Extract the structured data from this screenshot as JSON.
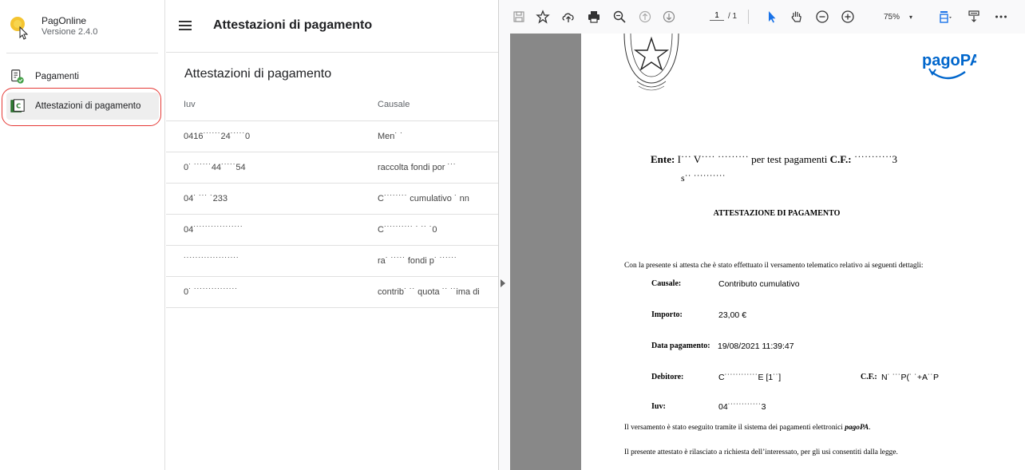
{
  "app": {
    "name": "PagOnline",
    "version": "Versione 2.4.0"
  },
  "sidebar": {
    "items": [
      {
        "label": "Pagamenti",
        "icon": "document-check-icon"
      },
      {
        "label": "Attestazioni di pagamento",
        "icon": "receipt-icon",
        "active": true
      }
    ]
  },
  "header": {
    "title": "Attestazioni di pagamento"
  },
  "list": {
    "title": "Attestazioni di pagamento",
    "columns": [
      "Iuv",
      "Causale"
    ],
    "rows": [
      {
        "iuv": "0416˙˙˙˙˙˙24˙˙˙˙˙0",
        "causale": "Men˙ ˙"
      },
      {
        "iuv": "0˙ ˙˙˙˙˙˙44˙˙˙˙˙54",
        "causale": "raccolta fondi por ˙˙˙"
      },
      {
        "iuv": "04˙ ˙˙˙             ˙233",
        "causale": "C˙˙˙˙˙˙˙˙ cumulativo ˙ nn"
      },
      {
        "iuv": "04˙˙˙˙˙˙˙˙˙˙˙˙˙˙˙˙˙",
        "causale": "C˙˙˙˙˙˙˙˙˙˙ ˙ ˙˙ ˙0"
      },
      {
        "iuv": "˙˙˙˙˙˙˙˙˙˙˙˙˙˙˙˙˙˙˙",
        "causale": "ra˙ ˙˙˙˙˙ fondi p˙ ˙˙˙˙˙˙"
      },
      {
        "iuv": "0˙ ˙˙˙˙˙˙˙˙˙˙˙˙˙˙˙",
        "causale": "contrib˙ ˙˙ quota ˙˙ ˙˙ima di"
      }
    ]
  },
  "viewer": {
    "page_current": "1",
    "page_total": "/ 1",
    "zoom": "75%",
    "toolbar_icons": [
      "save-icon",
      "bookmark-star-icon",
      "upload-icon",
      "print-icon",
      "zoom-search-icon",
      "page-up-icon",
      "page-down-icon",
      "select-pointer-icon",
      "hand-icon",
      "zoom-out-icon",
      "zoom-in-icon",
      "fit-width-icon",
      "download-icon",
      "more-icon"
    ]
  },
  "document": {
    "ente_label": "Ente:",
    "ente_name": "I˙˙˙ V˙˙˙˙ ˙˙˙˙˙˙˙˙˙ per test pagamenti",
    "cf_label": "C.F.:",
    "cf_value": "˙˙˙˙˙˙˙˙˙˙˙3",
    "ente_line2": "s˙˙ ˙˙˙˙˙˙˙˙˙˙",
    "title": "ATTESTAZIONE DI PAGAMENTO",
    "intro": "Con la presente si attesta che è stato effettuato il versamento telematico relativo ai seguenti dettagli:",
    "fields": {
      "causale_label": "Causale:",
      "causale_value": "Contributo cumulativo",
      "importo_label": "Importo:",
      "importo_value": "23,00 €",
      "data_label": "Data pagamento:",
      "data_value": "19/08/2021 11:39:47",
      "debitore_label": "Debitore:",
      "debitore_value": "C˙˙˙˙˙˙˙˙˙˙˙˙E [1˙˙]",
      "debitore_cf_label": "C.F.:",
      "debitore_cf_value": "N˙ ˙˙˙P(˙ ˙+A˙˙P",
      "iuv_label": "Iuv:",
      "iuv_value": "04˙˙˙˙˙˙˙˙˙˙˙˙3"
    },
    "footer1_pre": "Il versamento è stato eseguito tramite il sistema dei pagamenti elettronici ",
    "footer1_em": "pagoPA",
    "footer1_post": ".",
    "footer2": "Il presente attestato è rilasciato a richiesta dell’interessato, per gli usi consentiti dalla legge.",
    "logo_text": "pagoPA"
  },
  "colors": {
    "accent_red": "#e53935",
    "pagopa_blue": "#0066cc",
    "canvas_grey": "#888888",
    "active_bg": "#eeeeee"
  }
}
